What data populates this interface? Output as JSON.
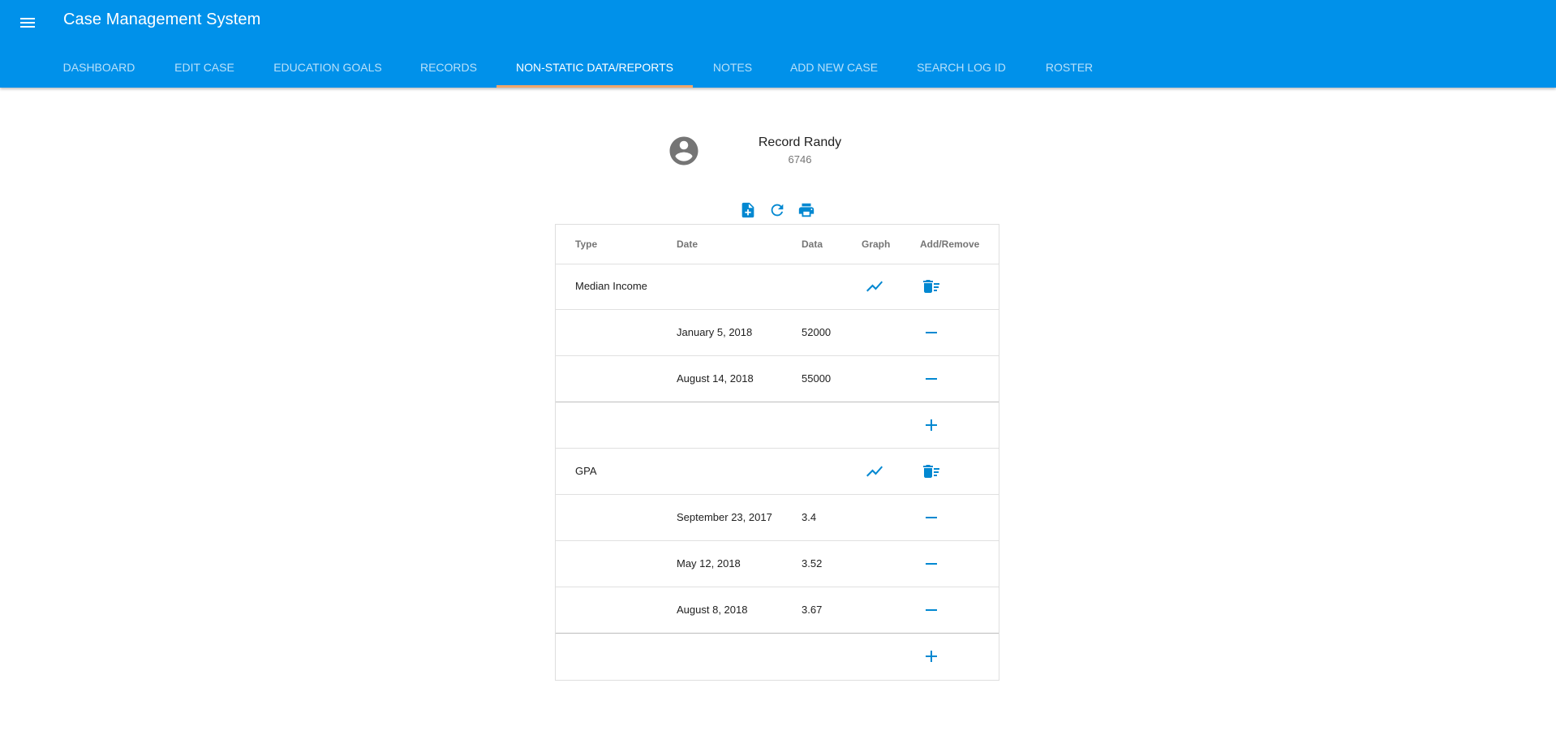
{
  "app": {
    "title": "Case Management System"
  },
  "tabs": [
    {
      "label": "DASHBOARD"
    },
    {
      "label": "EDIT CASE"
    },
    {
      "label": "EDUCATION GOALS"
    },
    {
      "label": "RECORDS"
    },
    {
      "label": "NON-STATIC DATA/REPORTS"
    },
    {
      "label": "NOTES"
    },
    {
      "label": "ADD NEW CASE"
    },
    {
      "label": "SEARCH LOG ID"
    },
    {
      "label": "ROSTER"
    }
  ],
  "active_tab": "NON-STATIC DATA/REPORTS",
  "profile": {
    "name": "Record Randy",
    "id": "6746"
  },
  "table": {
    "headers": {
      "type": "Type",
      "date": "Date",
      "data": "Data",
      "graph": "Graph",
      "add_remove": "Add/Remove"
    },
    "groups": [
      {
        "type": "Median Income",
        "entries": [
          {
            "date": "January 5, 2018",
            "data": "52000"
          },
          {
            "date": "August 14, 2018",
            "data": "55000"
          }
        ]
      },
      {
        "type": "GPA",
        "entries": [
          {
            "date": "September 23, 2017",
            "data": "3.4"
          },
          {
            "date": "May 12, 2018",
            "data": "3.52"
          },
          {
            "date": "August 8, 2018",
            "data": "3.67"
          }
        ]
      }
    ]
  },
  "colors": {
    "primary": "#0091ea",
    "tab_indicator": "#f0a66a",
    "icon_blue": "#0288d1"
  }
}
